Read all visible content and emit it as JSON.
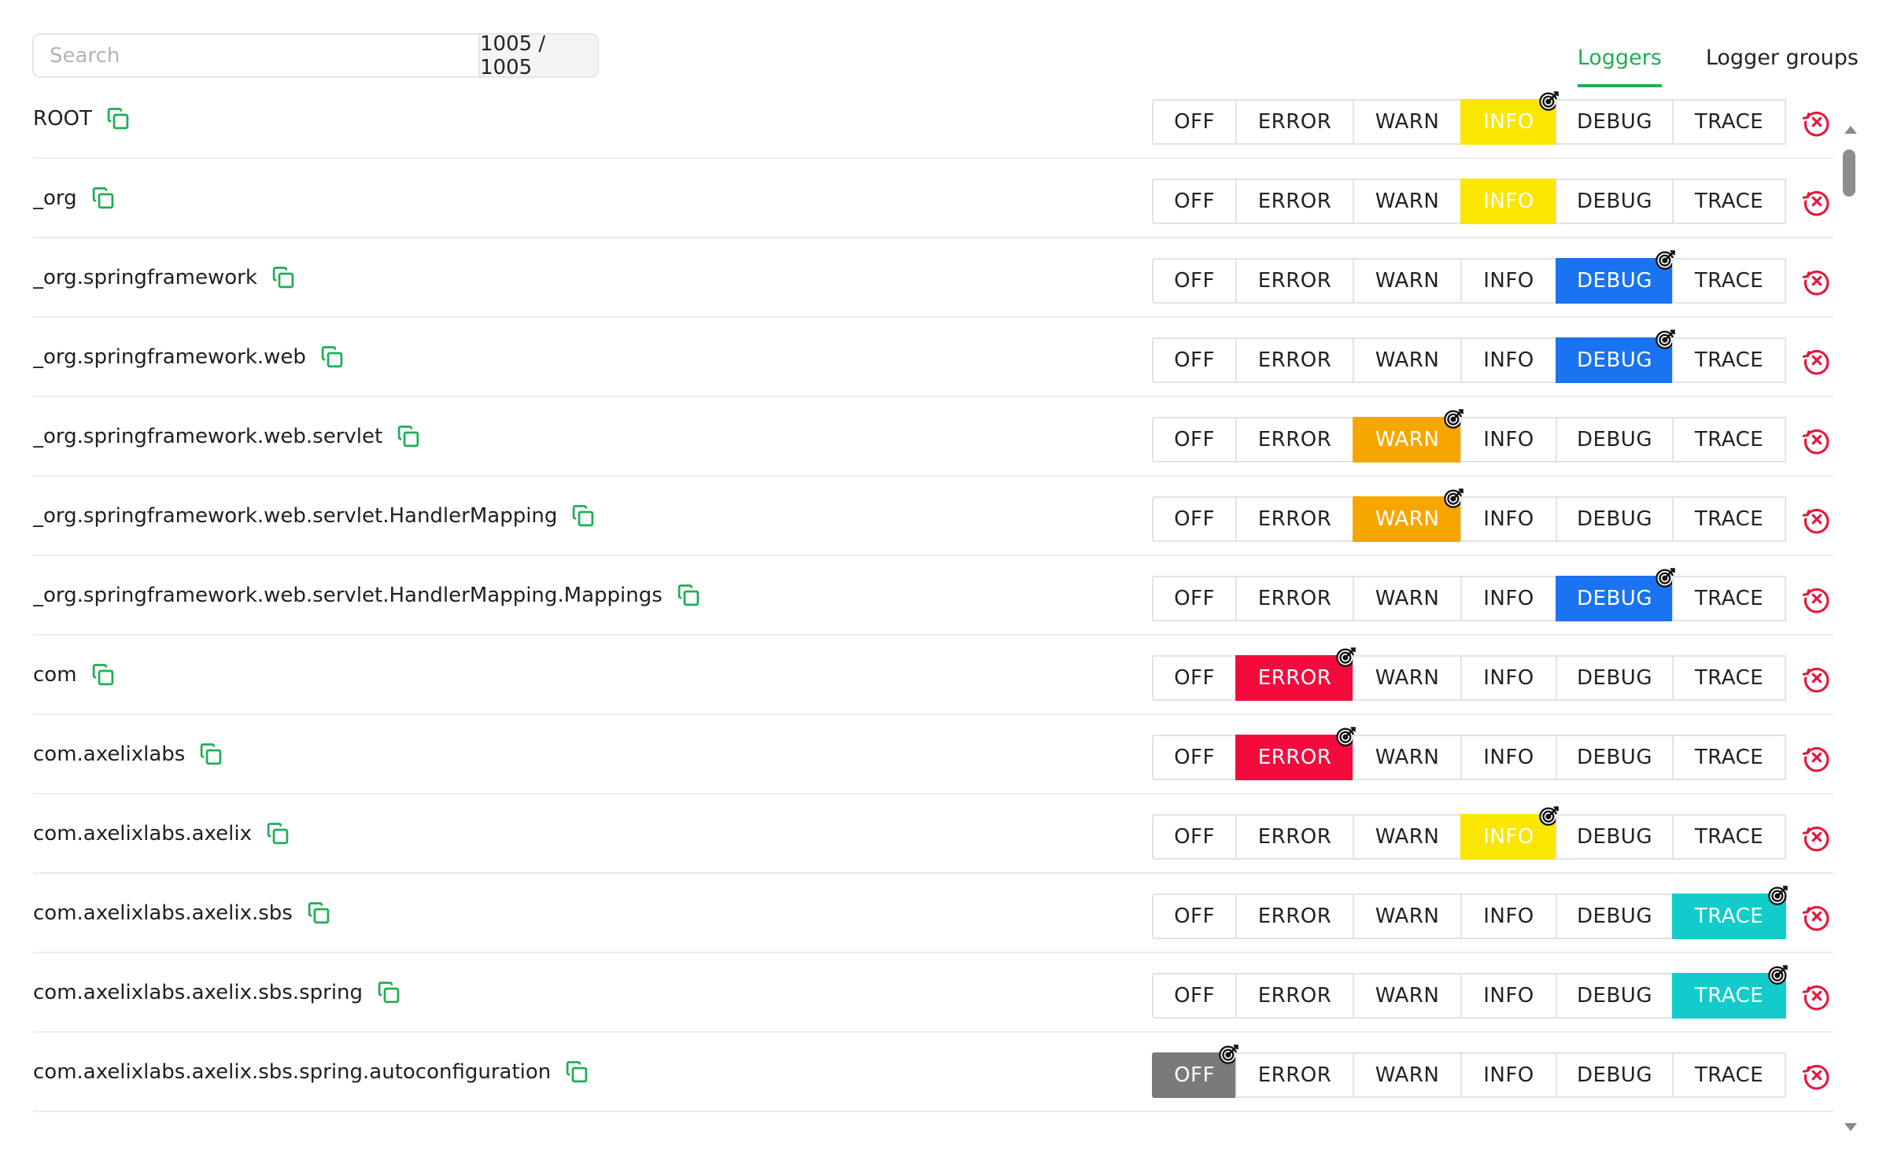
{
  "search": {
    "placeholder": "Search",
    "count": "1005 / 1005"
  },
  "tabs": [
    {
      "label": "Loggers",
      "active": true
    },
    {
      "label": "Logger groups",
      "active": false
    }
  ],
  "levels": [
    "OFF",
    "ERROR",
    "WARN",
    "INFO",
    "DEBUG",
    "TRACE"
  ],
  "colors": {
    "accent": "#1fae55",
    "info": "#fbe600",
    "debug": "#1a73f0",
    "warn": "#f7a600",
    "error": "#f30b3c",
    "trace": "#12cccc",
    "off": "#7a7a7a",
    "reset": "#e3183d"
  },
  "loggers": [
    {
      "name": "ROOT",
      "level": "INFO",
      "configured": true
    },
    {
      "name": "_org",
      "level": "INFO",
      "configured": false
    },
    {
      "name": "_org.springframework",
      "level": "DEBUG",
      "configured": true
    },
    {
      "name": "_org.springframework.web",
      "level": "DEBUG",
      "configured": true
    },
    {
      "name": "_org.springframework.web.servlet",
      "level": "WARN",
      "configured": true
    },
    {
      "name": "_org.springframework.web.servlet.HandlerMapping",
      "level": "WARN",
      "configured": true
    },
    {
      "name": "_org.springframework.web.servlet.HandlerMapping.Mappings",
      "level": "DEBUG",
      "configured": true
    },
    {
      "name": "com",
      "level": "ERROR",
      "configured": true
    },
    {
      "name": "com.axelixlabs",
      "level": "ERROR",
      "configured": true
    },
    {
      "name": "com.axelixlabs.axelix",
      "level": "INFO",
      "configured": true
    },
    {
      "name": "com.axelixlabs.axelix.sbs",
      "level": "TRACE",
      "configured": true
    },
    {
      "name": "com.axelixlabs.axelix.sbs.spring",
      "level": "TRACE",
      "configured": true
    },
    {
      "name": "com.axelixlabs.axelix.sbs.spring.autoconfiguration",
      "level": "OFF",
      "configured": true
    }
  ],
  "icons": {
    "copy": "copy-icon",
    "target": "target-icon",
    "reset": "reset-icon"
  }
}
